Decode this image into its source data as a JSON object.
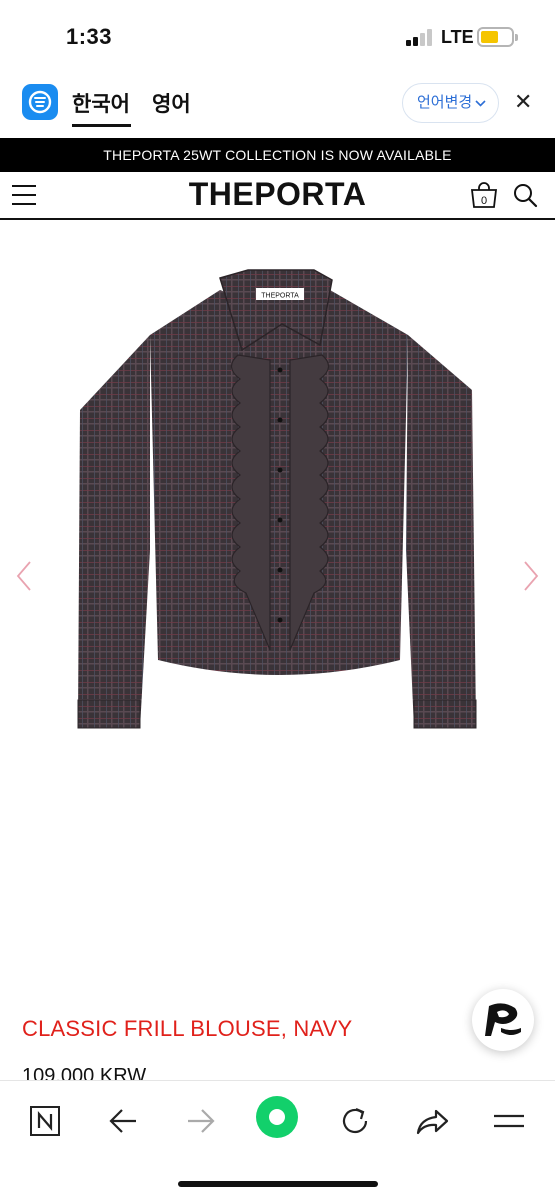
{
  "status_bar": {
    "time": "1:33",
    "network": "LTE",
    "battery_color": "#f5c500"
  },
  "translate_bar": {
    "lang_current": "한국어",
    "lang_other": "영어",
    "change_label": "언어변경",
    "close": "✕"
  },
  "announcement": "THEPORTA 25WT COLLECTION IS NOW AVAILABLE",
  "header": {
    "logo": "THEPORTA",
    "cart_count": "0"
  },
  "product_image": {
    "label_tag": "THEPORTA"
  },
  "product": {
    "name": "CLASSIC FRILL BLOUSE, NAVY",
    "price": "109,000 KRW"
  },
  "colors": {
    "product_name": "#e0211b",
    "nav_arrow": "#e9a3b0",
    "green_button": "#12d06b",
    "papago_blue": "#1a8cf0"
  },
  "icons": [
    "papago-icon",
    "hamburger-icon",
    "shopping-bag-icon",
    "search-icon",
    "chevron-left-icon",
    "chevron-right-icon",
    "naver-n-icon",
    "back-arrow-icon",
    "forward-arrow-icon",
    "green-dot-icon",
    "reload-icon",
    "share-icon",
    "menu-icon"
  ]
}
